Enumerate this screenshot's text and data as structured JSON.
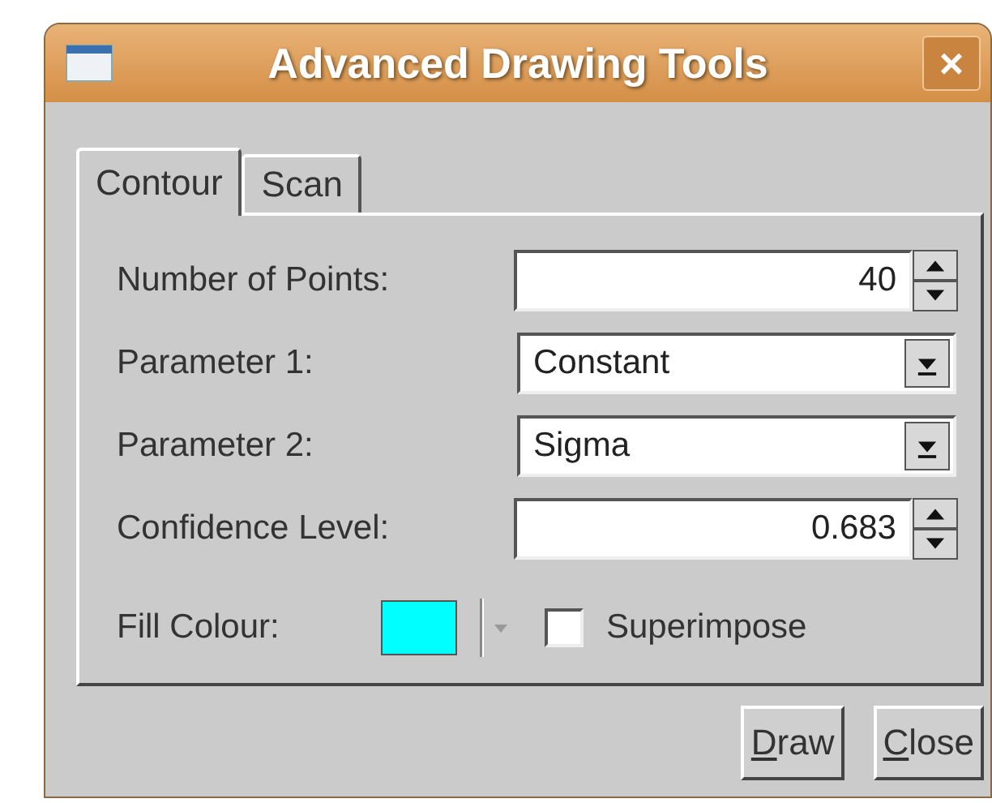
{
  "window": {
    "title": "Advanced Drawing Tools",
    "close": "×"
  },
  "tabs": [
    {
      "label": "Contour",
      "selected": true
    },
    {
      "label": "Scan",
      "selected": false
    }
  ],
  "fields": [
    {
      "kind": "spin",
      "label": "Number of Points:",
      "value": "40"
    },
    {
      "kind": "combo",
      "label": "Parameter 1:",
      "value": "Constant"
    },
    {
      "kind": "combo",
      "label": "Parameter 2:",
      "value": "Sigma"
    },
    {
      "kind": "spin",
      "label": "Confidence Level:",
      "value": "0.683"
    }
  ],
  "fill": {
    "label": "Fill Colour:",
    "color": "#00ffff"
  },
  "superimpose": {
    "label": "Superimpose",
    "checked": false
  },
  "buttons": [
    {
      "label": "Draw",
      "underline_first": true
    },
    {
      "label": "Close",
      "underline_first": true
    }
  ]
}
